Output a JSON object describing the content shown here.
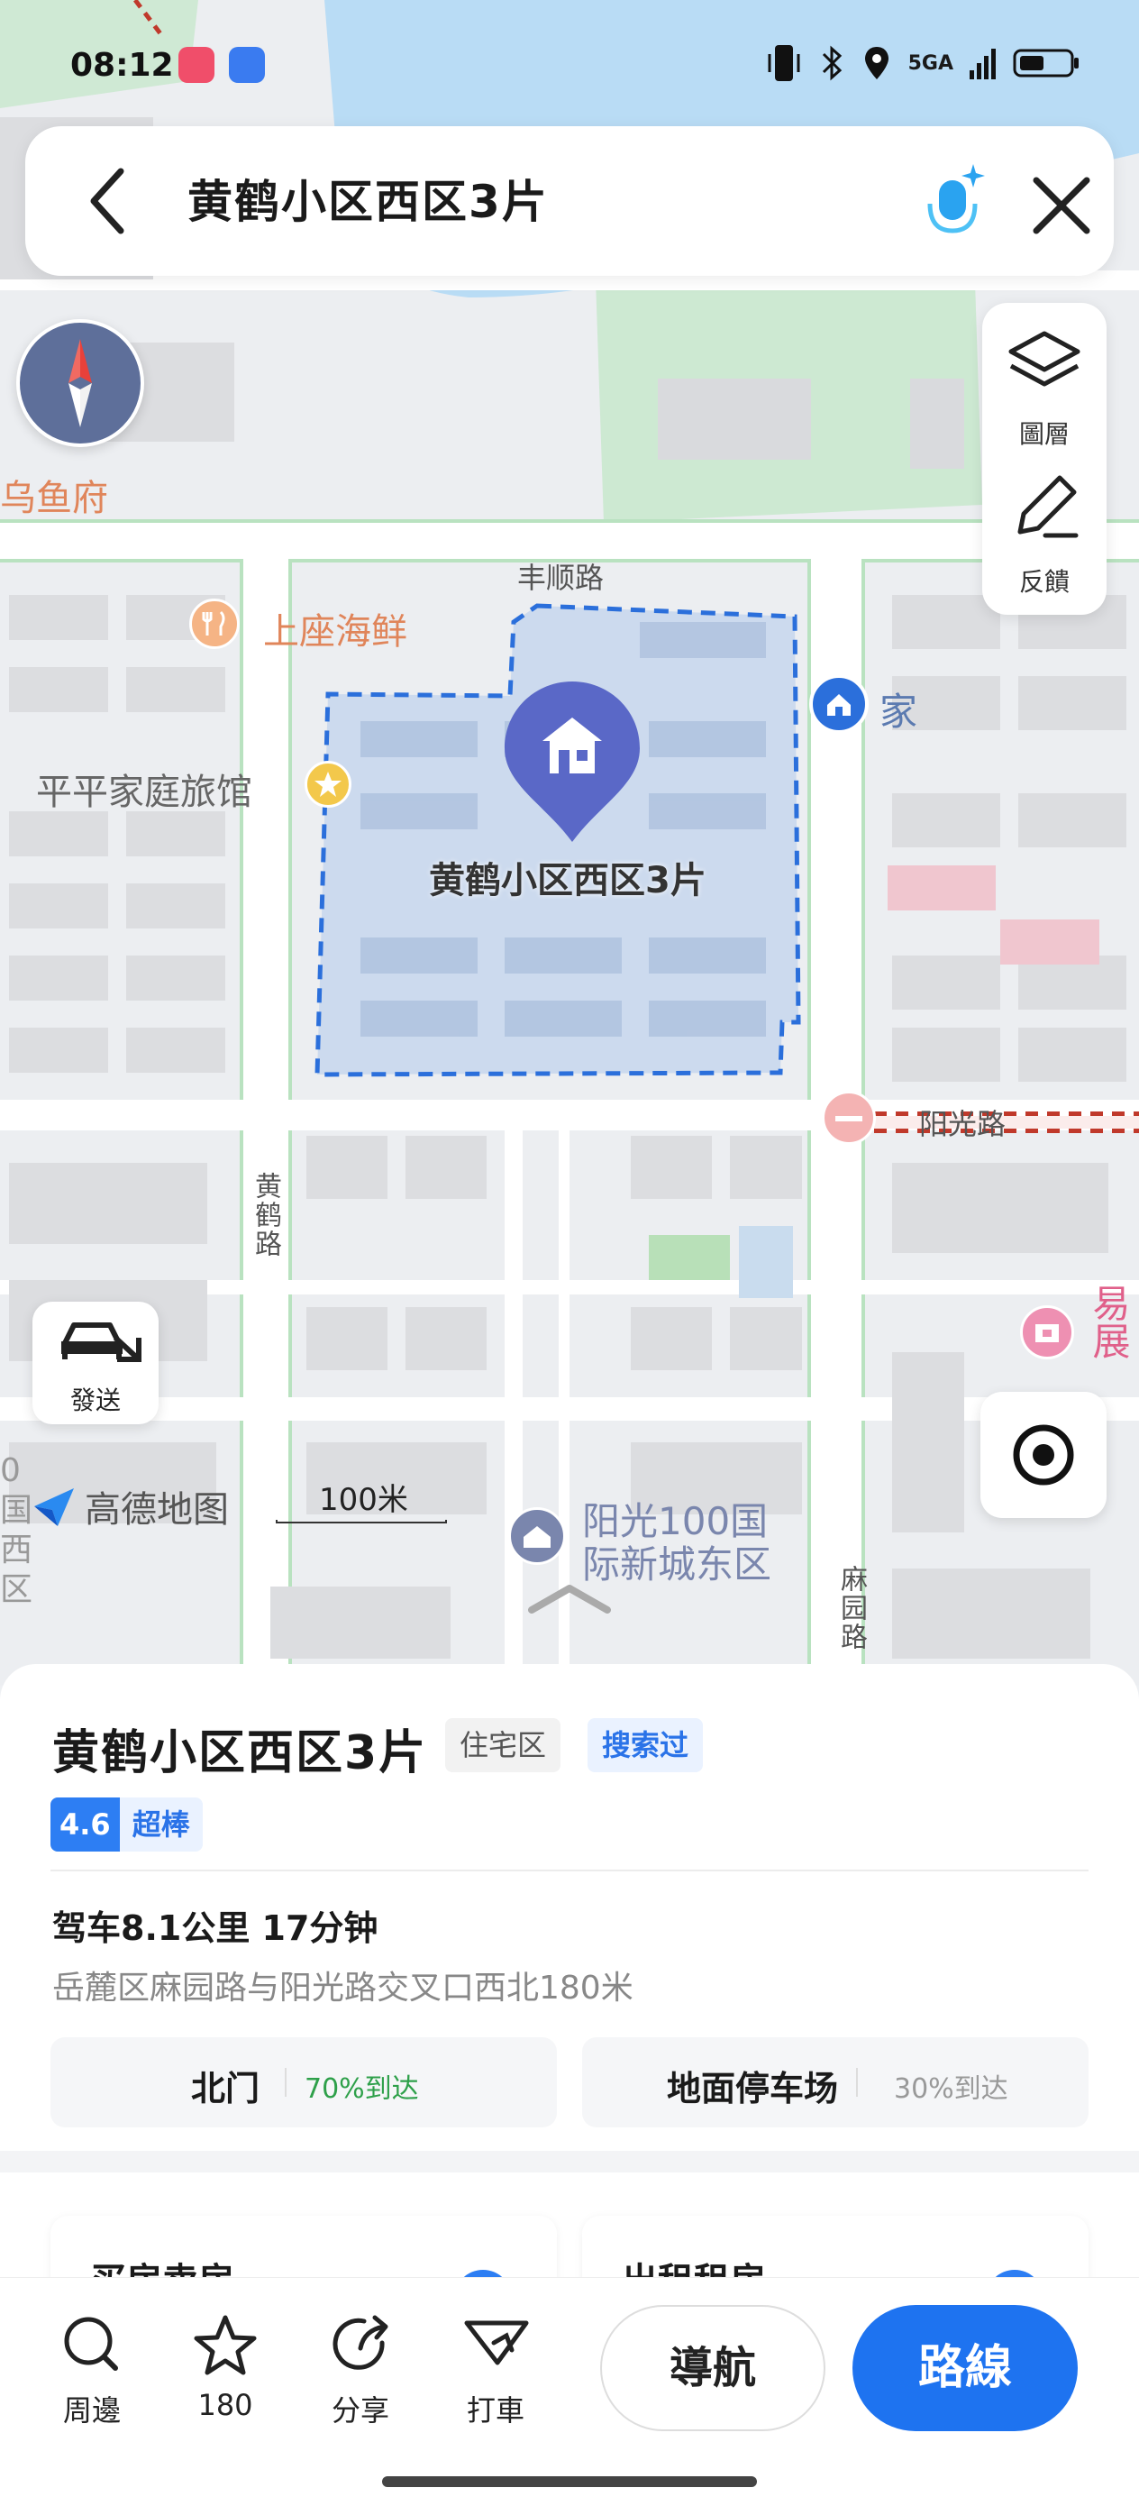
{
  "status_bar": {
    "time": "08:12",
    "network": "5GA"
  },
  "search": {
    "query": "黄鹤小区西区3片"
  },
  "tools": {
    "layers_label": "圖層",
    "feedback_label": "反饋"
  },
  "map": {
    "labels": {
      "poi_fish": "乌鱼府",
      "road_fengshun": "丰顺路",
      "poi_seafood": "上座海鲜",
      "poi_home": "家",
      "poi_hotel": "平平家庭旅馆",
      "marker_name": "黄鹤小区西区3片",
      "road_yangguang": "阳光路",
      "road_huanghe": "黄鹤路",
      "poi_exhibit": "易展",
      "poi_partial_left": "0国西区",
      "poi_sun_line1": "阳光100国",
      "poi_sun_line2": "际新城东区",
      "road_mayuan": "麻园路"
    },
    "logo_text": "高德地图",
    "scale_text": "100米",
    "send_label": "發送"
  },
  "place": {
    "name": "黄鹤小区西区3片",
    "type_tag": "住宅区",
    "history_tag": "搜索过",
    "rating_score": "4.6",
    "rating_word": "超棒",
    "drive_info": "驾车8.1公里 17分钟",
    "address": "岳麓区麻园路与阳光路交叉口西北180米",
    "entrances": [
      {
        "name": "北门",
        "percent": "70%到达",
        "percent_color": "#2ea04a"
      },
      {
        "name": "地面停车场",
        "percent": "30%到达",
        "percent_color": "#999999"
      }
    ],
    "cards": [
      {
        "title": "买房卖房"
      },
      {
        "title": "出租租房"
      }
    ]
  },
  "nav": {
    "nearby": "周邊",
    "favorites_count": "180",
    "share": "分享",
    "taxi": "打車",
    "navigate": "導航",
    "route": "路線"
  },
  "colors": {
    "accent": "#1e73f0",
    "highlight_area": "#bcd0ec",
    "boundary": "#2b6fdb"
  }
}
